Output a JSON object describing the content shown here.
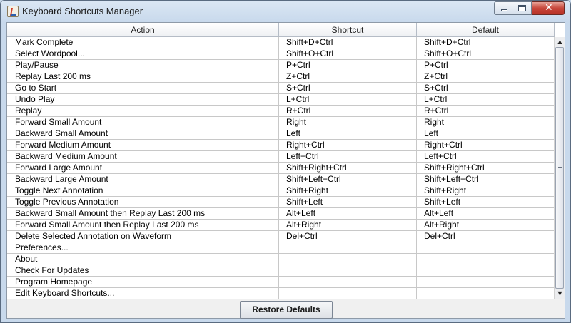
{
  "window": {
    "title": "Keyboard Shortcuts Manager",
    "controls": {
      "minimize": "minimize",
      "maximize": "maximize",
      "close": "✕"
    }
  },
  "table": {
    "headers": {
      "action": "Action",
      "shortcut": "Shortcut",
      "default": "Default"
    },
    "rows": [
      {
        "action": "Mark Complete",
        "shortcut": "Shift+D+Ctrl",
        "default": "Shift+D+Ctrl"
      },
      {
        "action": "Select Wordpool...",
        "shortcut": "Shift+O+Ctrl",
        "default": "Shift+O+Ctrl"
      },
      {
        "action": "Play/Pause",
        "shortcut": "P+Ctrl",
        "default": "P+Ctrl"
      },
      {
        "action": "Replay Last 200 ms",
        "shortcut": "Z+Ctrl",
        "default": "Z+Ctrl"
      },
      {
        "action": "Go to Start",
        "shortcut": "S+Ctrl",
        "default": "S+Ctrl"
      },
      {
        "action": "Undo Play",
        "shortcut": "L+Ctrl",
        "default": "L+Ctrl"
      },
      {
        "action": "Replay",
        "shortcut": "R+Ctrl",
        "default": "R+Ctrl"
      },
      {
        "action": "Forward Small Amount",
        "shortcut": "Right",
        "default": "Right"
      },
      {
        "action": "Backward Small Amount",
        "shortcut": "Left",
        "default": "Left"
      },
      {
        "action": "Forward Medium Amount",
        "shortcut": "Right+Ctrl",
        "default": "Right+Ctrl"
      },
      {
        "action": "Backward Medium Amount",
        "shortcut": "Left+Ctrl",
        "default": "Left+Ctrl"
      },
      {
        "action": "Forward Large Amount",
        "shortcut": "Shift+Right+Ctrl",
        "default": "Shift+Right+Ctrl"
      },
      {
        "action": "Backward Large Amount",
        "shortcut": "Shift+Left+Ctrl",
        "default": "Shift+Left+Ctrl"
      },
      {
        "action": "Toggle Next Annotation",
        "shortcut": "Shift+Right",
        "default": "Shift+Right"
      },
      {
        "action": "Toggle Previous Annotation",
        "shortcut": "Shift+Left",
        "default": "Shift+Left"
      },
      {
        "action": "Backward Small Amount then Replay Last 200 ms",
        "shortcut": "Alt+Left",
        "default": "Alt+Left"
      },
      {
        "action": "Forward Small Amount then Replay Last 200 ms",
        "shortcut": "Alt+Right",
        "default": "Alt+Right"
      },
      {
        "action": "Delete Selected Annotation on Waveform",
        "shortcut": "Del+Ctrl",
        "default": "Del+Ctrl"
      },
      {
        "action": "Preferences...",
        "shortcut": "",
        "default": ""
      },
      {
        "action": "About",
        "shortcut": "",
        "default": ""
      },
      {
        "action": "Check For Updates",
        "shortcut": "",
        "default": ""
      },
      {
        "action": "Program Homepage",
        "shortcut": "",
        "default": ""
      },
      {
        "action": "Edit Keyboard Shortcuts...",
        "shortcut": "",
        "default": ""
      }
    ]
  },
  "scrollbar": {
    "up_arrow": "▲",
    "down_arrow": "▼"
  },
  "footer": {
    "restore_label": "Restore Defaults"
  }
}
